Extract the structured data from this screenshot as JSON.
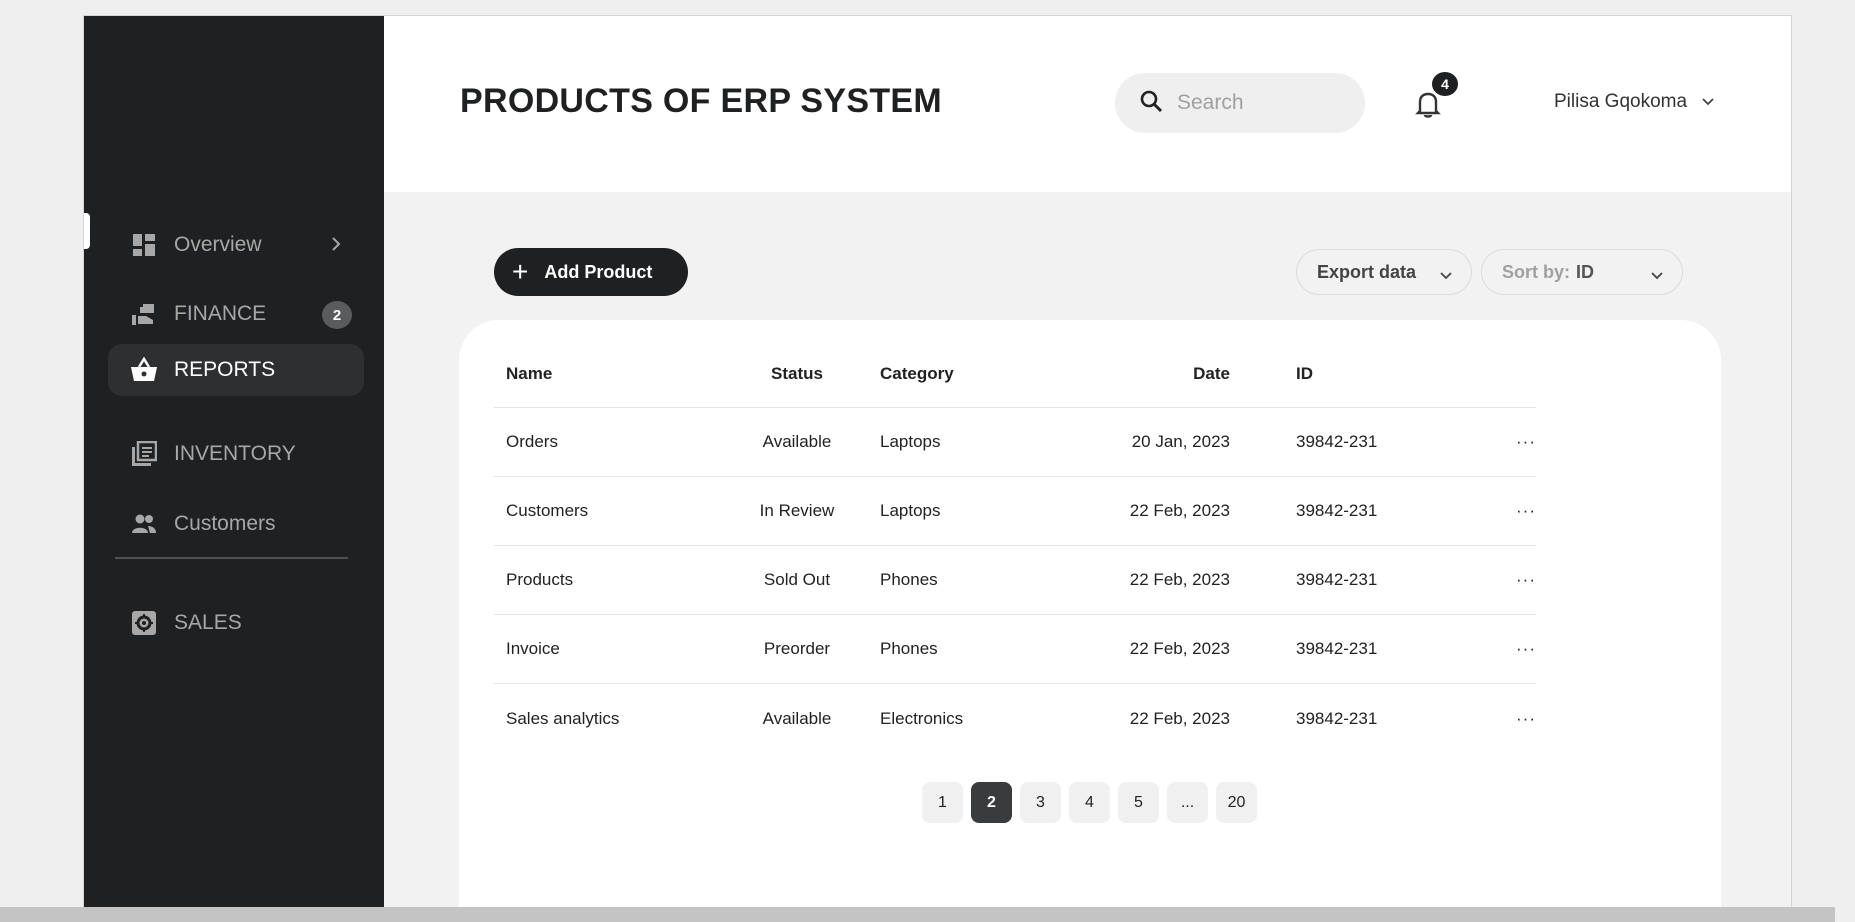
{
  "sidebar": {
    "items": [
      {
        "label": "Overview",
        "icon": "dashboard-icon"
      },
      {
        "label": "FINANCE",
        "icon": "finance-icon",
        "badge": "2"
      },
      {
        "label": "REPORTS",
        "icon": "basket-icon",
        "active": true
      },
      {
        "label": "INVENTORY",
        "icon": "library-icon"
      },
      {
        "label": "Customers",
        "icon": "people-icon"
      },
      {
        "label": "SALES",
        "icon": "gear-box-icon"
      }
    ]
  },
  "header": {
    "title": "PRODUCTS OF ERP SYSTEM",
    "search_placeholder": "Search",
    "notification_count": "4",
    "user_name": "Pilisa Gqokoma"
  },
  "toolbar": {
    "add_label": "Add Product",
    "export_label": "Export data",
    "sort_prefix": "Sort by:",
    "sort_value": "ID"
  },
  "table": {
    "columns": [
      "Name",
      "Status",
      "Category",
      "Date",
      "ID"
    ],
    "rows": [
      {
        "name": "Orders",
        "status": "Available",
        "category": "Laptops",
        "date": "20 Jan, 2023",
        "id": "39842-231",
        "action": "···"
      },
      {
        "name": "Customers",
        "status": "In Review",
        "category": "Laptops",
        "date": "22 Feb, 2023",
        "id": "39842-231",
        "action": "···"
      },
      {
        "name": "Products",
        "status": "Sold Out",
        "category": "Phones",
        "date": "22 Feb, 2023",
        "id": "39842-231",
        "action": "···"
      },
      {
        "name": "Invoice",
        "status": "Preorder",
        "category": "Phones",
        "date": "22 Feb, 2023",
        "id": "39842-231",
        "action": "···"
      },
      {
        "name": "Sales analytics",
        "status": "Available",
        "category": "Electronics",
        "date": "22 Feb, 2023",
        "id": "39842-231",
        "action": "···"
      }
    ]
  },
  "pagination": {
    "pages": [
      "1",
      "2",
      "3",
      "4",
      "5",
      "...",
      "20"
    ],
    "current": "2"
  },
  "colors": {
    "sidebar_bg": "#1f2022",
    "accent": "#1f2022",
    "content_bg": "#f2f2f2"
  }
}
